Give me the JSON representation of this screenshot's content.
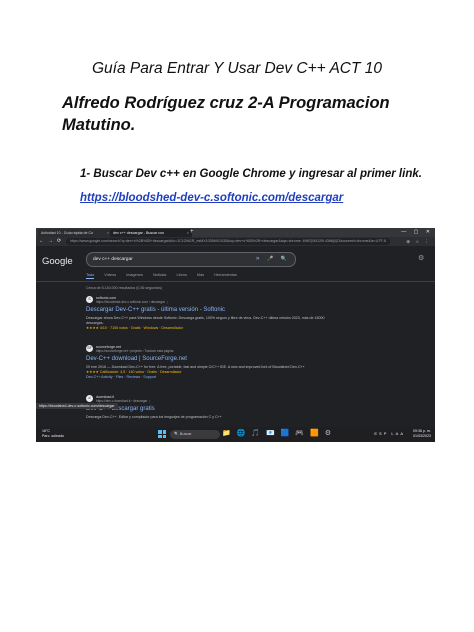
{
  "document": {
    "title": "Guía Para Entrar Y Usar Dev C++ ACT 10",
    "author": "Alfredo Rodríguez cruz 2-A Programacion Matutino.",
    "step1": "1- Buscar Dev c++ en Google Chrome y ingresar al primer link.",
    "link": "https://bloodshed-dev-c.softonic.com/descargar"
  },
  "browser": {
    "tabs": [
      {
        "label": "Actividad 10 - Guía rápida de Co",
        "close": "×"
      },
      {
        "label": "dev c++ descargar - Buscar con",
        "close": "×"
      }
    ],
    "new_tab": "+",
    "window_controls": "— ▢ ✕",
    "nav": {
      "back": "←",
      "forward": "→",
      "reload": "⟳"
    },
    "url": "https://www.google.com/search?q=dev+c%2B%2B+descargar&rlz=1C1ONGR_esMX1035MX1035&oq=dev+c%2B%2B+descargar&aqs=chrome..69i57j0i512l9.4386j0j7&sourceid=chrome&ie=UTF-8",
    "url_icons": "⊕ ☆ ⋮"
  },
  "google": {
    "logo": "Google",
    "query": "dev c++ descargar",
    "search_icons": "✕ 🎤 🔍",
    "tabs": [
      "Todo",
      "Vídeos",
      "Imágenes",
      "Noticias",
      "Libros",
      "Más",
      "Herramientas"
    ],
    "stats": "Cerca de 5.140.000 resultados (0,36 segundos)"
  },
  "results": [
    {
      "favicon": "S",
      "site": "softonic.com",
      "cite": "https://bloodshed-dev-c.softonic.com › descargar ⋮",
      "title": "Descargar Dev-C++ gratis - última versión - Softonic",
      "snippet": "Descargar ahora Dev-C++ para Windows desde Softonic: Descarga gratis, 100% seguro y libre de virus. Dev-C++ última versión 2023, más de 15000 descargas.",
      "rating": "★★★★ 4/10 · 7105 votos · Gratis · Windows · Desarrollador"
    },
    {
      "favicon": "SF",
      "site": "sourceforge.net",
      "cite": "https://sourceforge.net › projects › Traducir esta página",
      "title": "Dev-C++ download | SourceForge.net",
      "snippet": "29 ene 2016 — Download Dev-C++ for free. A free, portable, fast and simple C/C++ IDE. A new and improved fork of Bloodshed Dev-C++",
      "rating": "★★★★ Calificación: 4,5 · 140 votos · Gratis · Desarrollador",
      "extra": "Dev-C++ Activity · Files · Reviews · Support"
    },
    {
      "favicon": "d",
      "site": "download.it",
      "cite": "https://dev-c.download.it › descargar ⋮",
      "title": "Dev-C++ descargar gratis",
      "snippet": "Descarga Dev-C++. Editor y compilador para los lenguajes de programación C y C++"
    }
  ],
  "status_url": "https://bloodshed-dev-c.softonic.com/descargar",
  "taskbar": {
    "weather_temp": "16°C",
    "weather_desc": "Parc. soleado",
    "search_label": "Buscar",
    "time": "09:36 p. m.",
    "date": "01/03/2023",
    "lang": "ESP LAA",
    "app_icons": [
      "📁",
      "🌐",
      "🎵",
      "📧",
      "🟦",
      "🎮",
      "🟧",
      "⚙"
    ]
  },
  "colors": {
    "link_blue": "#1f3fbf",
    "google_link": "#8ab4f8",
    "dark_bg": "#202124"
  }
}
